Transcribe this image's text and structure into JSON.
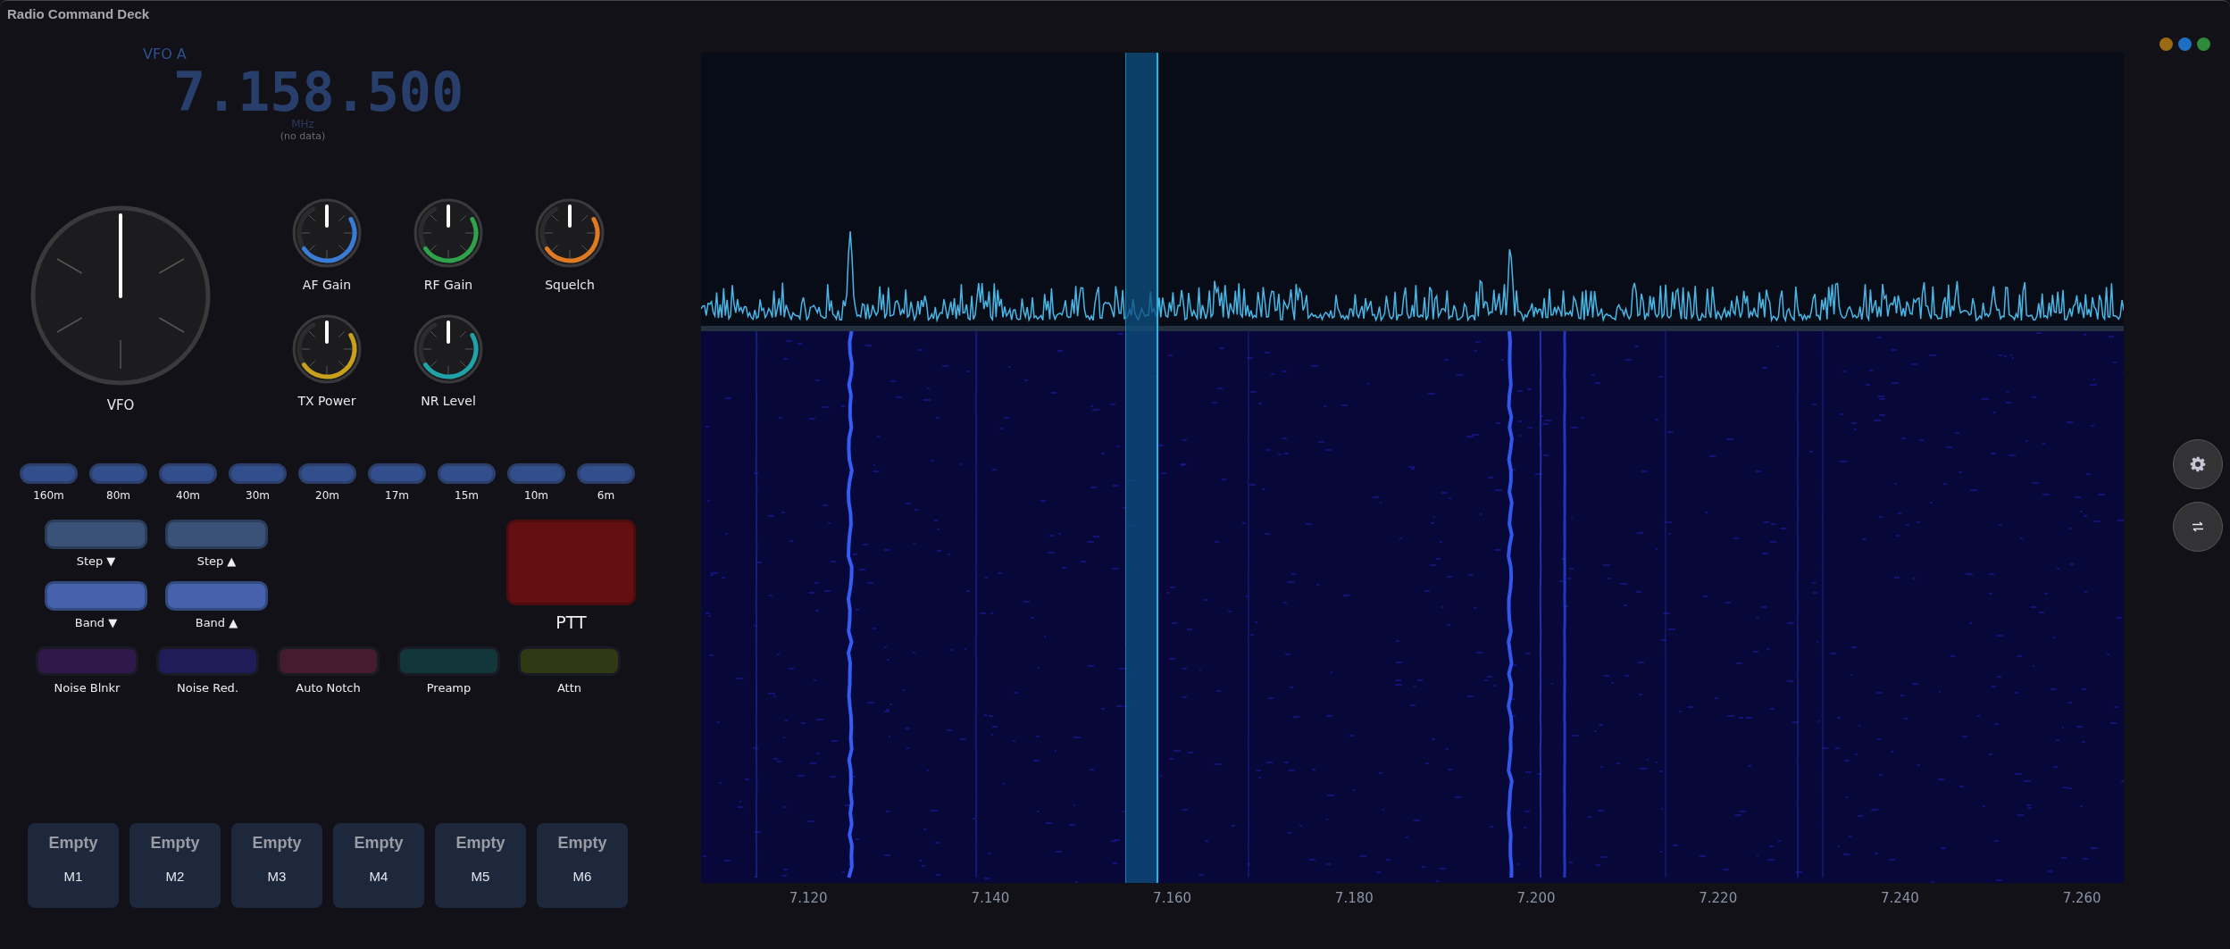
{
  "window": {
    "title": "Radio Command Deck",
    "controls": [
      {
        "color": "#9a6a14"
      },
      {
        "color": "#1e6fc4"
      },
      {
        "color": "#2e8b3a"
      }
    ]
  },
  "vfo": {
    "label": "VFO A",
    "frequency": "7.158.500",
    "unit": "MHz",
    "note": "(no data)",
    "knob_label": "VFO"
  },
  "knobs": [
    {
      "label": "AF Gain",
      "color": "#3a7bd5",
      "level": 0.65
    },
    {
      "label": "RF Gain",
      "color": "#2ea34a",
      "level": 0.65
    },
    {
      "label": "Squelch",
      "color": "#e07a22",
      "level": 0.65
    },
    {
      "label": "TX Power",
      "color": "#c9a01c",
      "level": 0.65
    },
    {
      "label": "NR Level",
      "color": "#1fa3a8",
      "level": 0.65
    }
  ],
  "bands": [
    "160m",
    "80m",
    "40m",
    "30m",
    "20m",
    "17m",
    "15m",
    "10m",
    "6m"
  ],
  "tuning_buttons": [
    {
      "label": "Step ▼",
      "kind": "step"
    },
    {
      "label": "Step ▲",
      "kind": "step"
    },
    {
      "label": "Band ▼",
      "kind": "band"
    },
    {
      "label": "Band ▲",
      "kind": "band"
    }
  ],
  "ptt": {
    "label": "PTT"
  },
  "toggles": [
    {
      "label": "Noise Blnkr",
      "color": "#30194a"
    },
    {
      "label": "Noise Red.",
      "color": "#201c58"
    },
    {
      "label": "Auto Notch",
      "color": "#451b30"
    },
    {
      "label": "Preamp",
      "color": "#13363a"
    },
    {
      "label": "Attn",
      "color": "#2f3a14"
    }
  ],
  "memories": [
    {
      "name": "Empty",
      "slot": "M1"
    },
    {
      "name": "Empty",
      "slot": "M2"
    },
    {
      "name": "Empty",
      "slot": "M3"
    },
    {
      "name": "Empty",
      "slot": "M4"
    },
    {
      "name": "Empty",
      "slot": "M5"
    },
    {
      "name": "Empty",
      "slot": "M6"
    }
  ],
  "spectrum": {
    "axis_labels": [
      "7.120",
      "7.140",
      "7.160",
      "7.180",
      "7.200",
      "7.220",
      "7.240",
      "7.260"
    ]
  }
}
